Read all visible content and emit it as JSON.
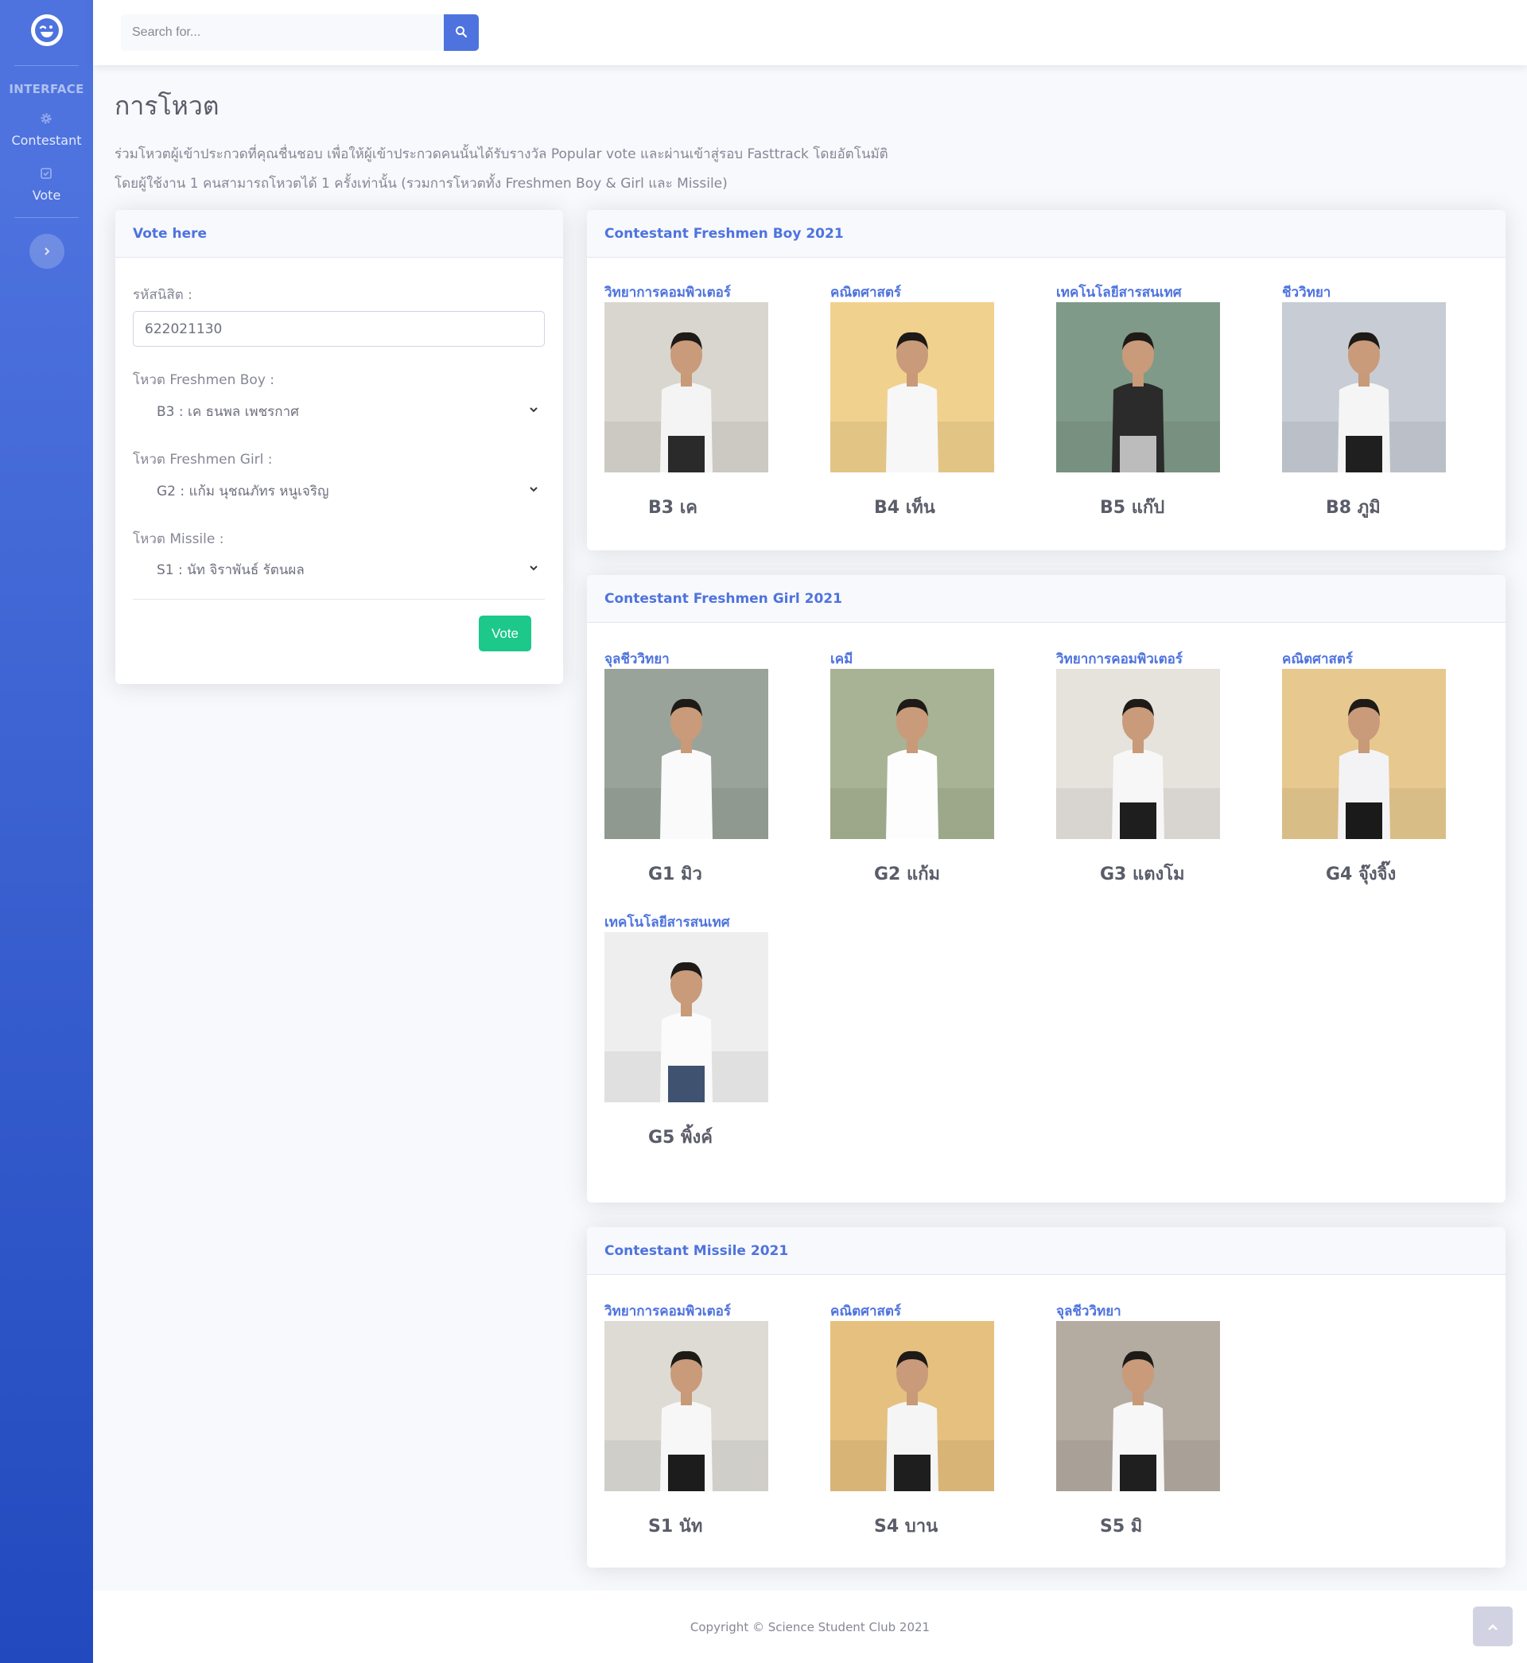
{
  "sidebar": {
    "brand_icon": "grin-wink-icon",
    "heading": "INTERFACE",
    "items": [
      {
        "label": "Contestant",
        "icon": "cog-icon"
      },
      {
        "label": "Vote",
        "icon": "check-square-icon"
      }
    ],
    "toggle_icon": "chevron-right-icon"
  },
  "topbar": {
    "search_placeholder": "Search for...",
    "search_icon": "search-icon"
  },
  "page": {
    "title": "การโหวต",
    "desc_line1": "ร่วมโหวตผู้เข้าประกวดที่คุณชื่นชอบ เพื่อให้ผู้เข้าประกวดคนนั้นได้รับรางวัล Popular vote และผ่านเข้าสู่รอบ Fasttrack โดยอัตโนมัติ",
    "desc_line2": "โดยผู้ใช้งาน 1 คนสามารถโหวตได้ 1 ครั้งเท่านั้น (รวมการโหวตทั้ง Freshmen Boy & Girl และ Missile)"
  },
  "vote_form": {
    "header": "Vote here",
    "student_id_label": "รหัสนิสิต :",
    "student_id_value": "622021130",
    "boy_label": "โหวต Freshmen Boy :",
    "boy_value": "B3 : เค ธนพล เพชรกาศ",
    "girl_label": "โหวต Freshmen Girl :",
    "girl_value": "G2 : แก้ม นุชณภัทร หนูเจริญ",
    "missile_label": "โหวต Missile :",
    "missile_value": "S1 : นัท จิราพันธ์ รัตนผล",
    "submit_label": "Vote"
  },
  "boys": {
    "header": "Contestant Freshmen Boy 2021",
    "items": [
      {
        "faculty": "วิทยาการคอมพิวเตอร์",
        "name": "B3 เค",
        "bg": "#d9d6cf",
        "shirt": "#f4f4f4",
        "pants": "#2a2a2a"
      },
      {
        "faculty": "คณิตศาสตร์",
        "name": "B4 เท็น",
        "bg": "#f1d18e",
        "shirt": "#f7f7f7",
        "pants": "#f7f7f7"
      },
      {
        "faculty": "เทคโนโลยีสารสนเทศ",
        "name": "B5 แก๊ป",
        "bg": "#7f9a88",
        "shirt": "#2b2b2b",
        "pants": "#bcbcbc"
      },
      {
        "faculty": "ชีววิทยา",
        "name": "B8 ภูมิ",
        "bg": "#c7ccd5",
        "shirt": "#f5f5f5",
        "pants": "#1f1f1f"
      }
    ]
  },
  "girls": {
    "header": "Contestant Freshmen Girl 2021",
    "items": [
      {
        "faculty": "จุลชีววิทยา",
        "name": "G1 มิว",
        "bg": "#9aa39a",
        "shirt": "#fafafa",
        "pants": "#fafafa"
      },
      {
        "faculty": "เคมี",
        "name": "G2 แก้ม",
        "bg": "#a7b394",
        "shirt": "#fdfdfd",
        "pants": "#fdfdfd"
      },
      {
        "faculty": "วิทยาการคอมพิวเตอร์",
        "name": "G3 แตงโม",
        "bg": "#e6e2dc",
        "shirt": "#f7f7f7",
        "pants": "#1e1e1e"
      },
      {
        "faculty": "คณิตศาสตร์",
        "name": "G4 จุ๊งจิ๊ง",
        "bg": "#e7c98f",
        "shirt": "#f3f3f6",
        "pants": "#1a1a1a"
      },
      {
        "faculty": "เทคโนโลยีสารสนเทศ",
        "name": "G5 พิ้งค์",
        "bg": "#eeeeee",
        "shirt": "#fbfbfb",
        "pants": "#3f5370"
      }
    ]
  },
  "missiles": {
    "header": "Contestant Missile 2021",
    "items": [
      {
        "faculty": "วิทยาการคอมพิวเตอร์",
        "name": "S1 นัท",
        "bg": "#dedbd5",
        "shirt": "#f7f7f7",
        "pants": "#1c1c1c"
      },
      {
        "faculty": "คณิตศาสตร์",
        "name": "S4 บาน",
        "bg": "#e6c07f",
        "shirt": "#f5f5f5",
        "pants": "#1e1e1e"
      },
      {
        "faculty": "จุลชีววิทยา",
        "name": "S5 มิ",
        "bg": "#b4aba1",
        "shirt": "#f7f7f7",
        "pants": "#1f1f1f"
      }
    ]
  },
  "footer": {
    "copyright": "Copyright © Science Student Club 2021",
    "totop_icon": "angle-up-icon"
  },
  "colors": {
    "primary": "#4e73df",
    "success": "#1cc88a",
    "text": "#858796",
    "heading": "#5a5c69"
  }
}
